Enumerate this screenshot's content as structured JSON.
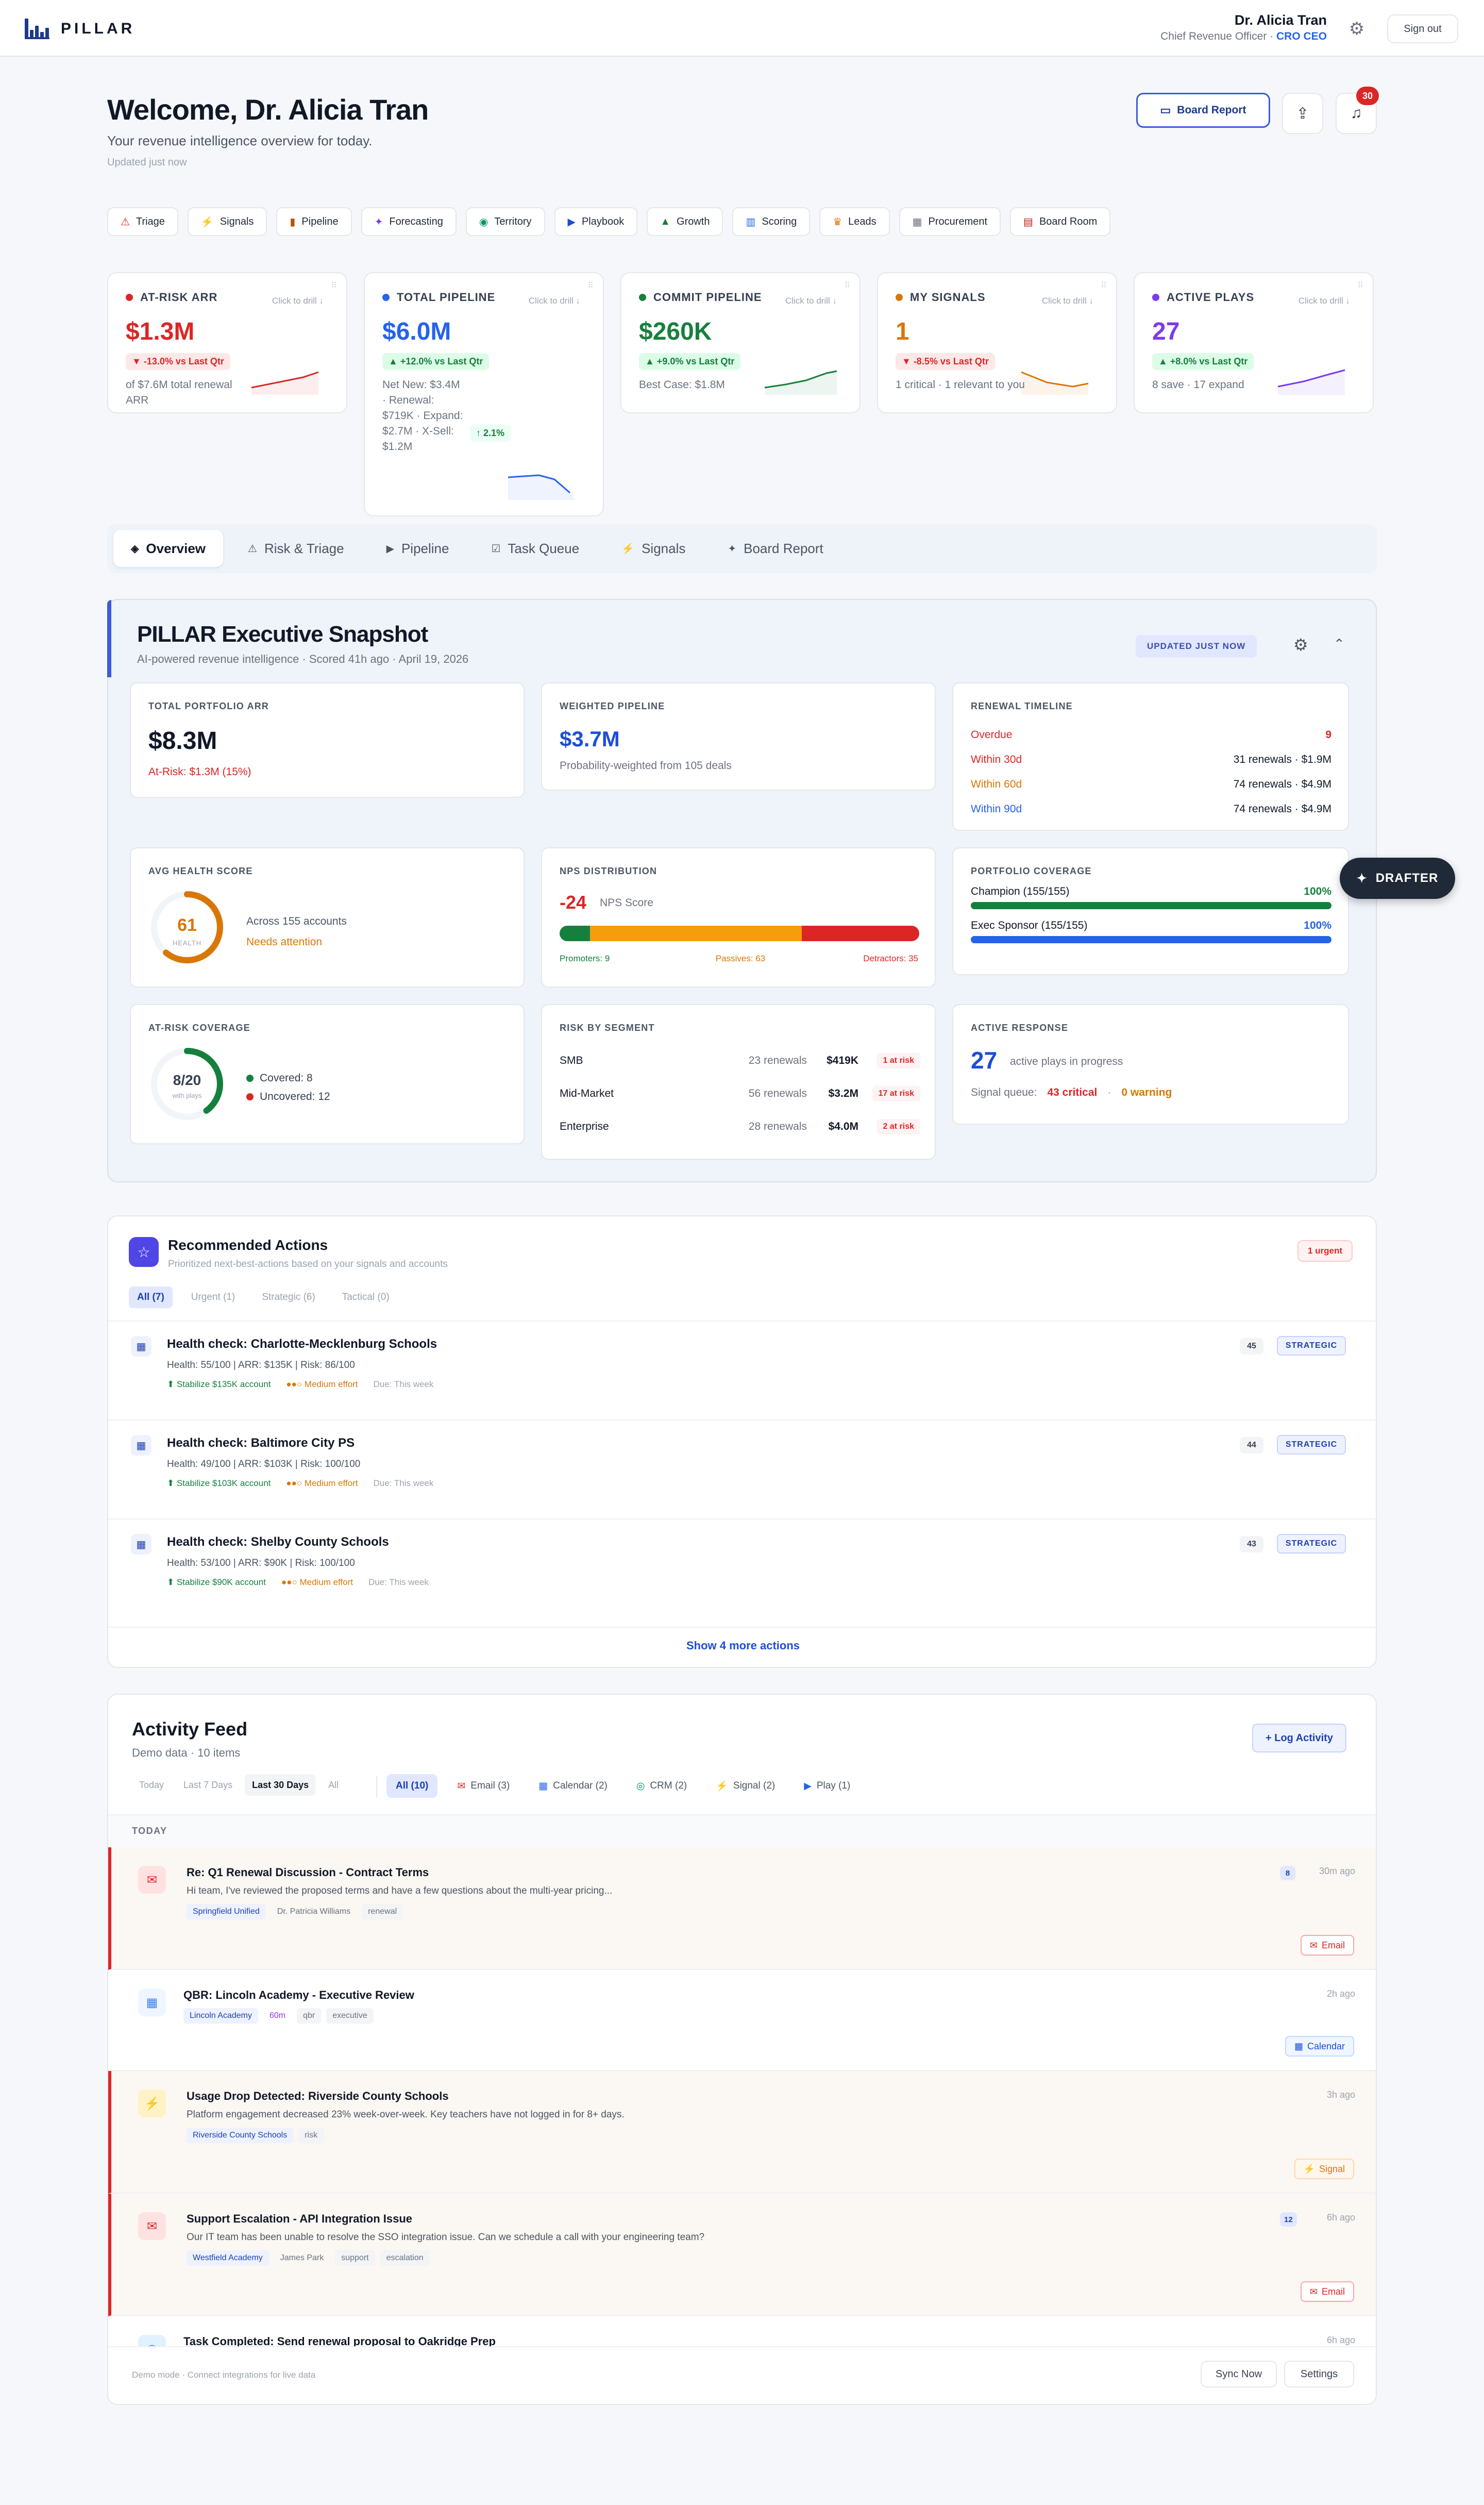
{
  "header": {
    "brand": "PILLAR",
    "user_name": "Dr. Alicia Tran",
    "user_role": "Chief Revenue Officer ·",
    "user_role_link": "CRO CEO",
    "signout_label": "Sign out"
  },
  "page": {
    "title": "Welcome, Dr. Alicia Tran",
    "subtitle": "Your revenue intelligence overview for today.",
    "updated": "Updated just now",
    "board_report_label": "Board Report",
    "notification_count": "30"
  },
  "nav_pills": [
    {
      "label": "Triage",
      "icon": "⚠"
    },
    {
      "label": "Signals",
      "icon": "⚡"
    },
    {
      "label": "Pipeline",
      "icon": "▮"
    },
    {
      "label": "Forecasting",
      "icon": "✦"
    },
    {
      "label": "Territory",
      "icon": "◉"
    },
    {
      "label": "Playbook",
      "icon": "▶"
    },
    {
      "label": "Growth",
      "icon": "▲"
    },
    {
      "label": "Scoring",
      "icon": "▥"
    },
    {
      "label": "Leads",
      "icon": "♛"
    },
    {
      "label": "Procurement",
      "icon": "▦"
    },
    {
      "label": "Board Room",
      "icon": "▤"
    }
  ],
  "kpis": [
    {
      "title": "AT-RISK ARR",
      "drill": "Click to drill ↓",
      "value": "$1.3M",
      "change": "▼ -13.0% vs Last Qtr",
      "note": "of $7.6M total renewal ARR",
      "color": "#dc2626"
    },
    {
      "title": "TOTAL PIPELINE",
      "drill": "Click to drill ↓",
      "value": "$6.0M",
      "change": "▲ +12.0% vs Last Qtr",
      "note": "Net New: $3.4M · Renewal: $719K · Expand: $2.7M · X-Sell: $1.2M",
      "extra": "↑ 2.1%",
      "color": "#2563eb"
    },
    {
      "title": "COMMIT PIPELINE",
      "drill": "Click to drill ↓",
      "value": "$260K",
      "change": "▲ +9.0% vs Last Qtr",
      "note": "Best Case: $1.8M",
      "color": "#15803d"
    },
    {
      "title": "MY SIGNALS",
      "drill": "Click to drill ↓",
      "value": "1",
      "change": "▼ -8.5% vs Last Qtr",
      "note": "1 critical · 1 relevant to you",
      "color": "#d97706"
    },
    {
      "title": "ACTIVE PLAYS",
      "drill": "Click to drill ↓",
      "value": "27",
      "change": "▲ +8.0% vs Last Qtr",
      "note": "8 save · 17 expand",
      "color": "#7c3aed"
    }
  ],
  "tabs": [
    {
      "label": "Overview",
      "icon": "◈"
    },
    {
      "label": "Risk & Triage",
      "icon": "⚠"
    },
    {
      "label": "Pipeline",
      "icon": "▶"
    },
    {
      "label": "Task Queue",
      "icon": "☑"
    },
    {
      "label": "Signals",
      "icon": "⚡"
    },
    {
      "label": "Board Report",
      "icon": "✦"
    }
  ],
  "snapshot": {
    "title": "PILLAR Executive Snapshot",
    "subtitle": "AI-powered revenue intelligence · Scored 41h ago · April 19, 2026",
    "updated_badge": "UPDATED JUST NOW",
    "total_arr": {
      "label": "TOTAL PORTFOLIO ARR",
      "value": "$8.3M",
      "risk": "At-Risk: $1.3M (15%)"
    },
    "weighted": {
      "label": "WEIGHTED PIPELINE",
      "value": "$3.7M",
      "note": "Probability-weighted from 105 deals"
    },
    "renewal": {
      "label": "RENEWAL TIMELINE",
      "rows": [
        {
          "name": "Overdue",
          "value": "9",
          "color": "#dc2626"
        },
        {
          "name": "Within 30d",
          "value": "31 renewals · $1.9M",
          "color": "#dc2626"
        },
        {
          "name": "Within 60d",
          "value": "74 renewals · $4.9M",
          "color": "#d97706"
        },
        {
          "name": "Within 90d",
          "value": "74 renewals · $4.9M",
          "color": "#2563eb"
        }
      ]
    },
    "health": {
      "label": "AVG HEALTH SCORE",
      "score": "61",
      "score_label": "HEALTH",
      "accounts": "Across 155 accounts",
      "status": "Needs attention",
      "fraction": 0.61
    },
    "nps": {
      "label": "NPS DISTRIBUTION",
      "score": "-24",
      "score_label": "NPS Score",
      "promoters": "Promoters: 9",
      "passives": "Passives: 63",
      "detractors": "Detractors: 35",
      "segments": [
        9,
        63,
        35
      ]
    },
    "coverage": {
      "label": "PORTFOLIO COVERAGE",
      "rows": [
        {
          "name": "Champion (155/155)",
          "pct": "100%",
          "color": "#15803d",
          "fraction": 1.0
        },
        {
          "name": "Exec Sponsor (155/155)",
          "pct": "100%",
          "color": "#2563eb",
          "fraction": 1.0
        }
      ]
    },
    "atrisk": {
      "label": "AT-RISK COVERAGE",
      "ratio": "8/20",
      "ratio_label": "with plays",
      "covered": "Covered: 8",
      "uncovered": "Uncovered: 12",
      "fraction": 0.4
    },
    "segment": {
      "label": "RISK BY SEGMENT",
      "rows": [
        {
          "name": "SMB",
          "renewals": "23 renewals",
          "arr": "$419K",
          "risk": "1 at risk"
        },
        {
          "name": "Mid-Market",
          "renewals": "56 renewals",
          "arr": "$3.2M",
          "risk": "17 at risk"
        },
        {
          "name": "Enterprise",
          "renewals": "28 renewals",
          "arr": "$4.0M",
          "risk": "2 at risk"
        }
      ]
    },
    "response": {
      "label": "ACTIVE RESPONSE",
      "count": "27",
      "count_label": "active plays in progress",
      "queue_label": "Signal queue:",
      "critical": "43 critical",
      "warning": "0 warning"
    }
  },
  "drafter_label": "DRAFTER",
  "recommended": {
    "title": "Recommended Actions",
    "subtitle": "Prioritized next-best-actions based on your signals and accounts",
    "urgent_badge": "1 urgent",
    "filters": [
      "All (7)",
      "Urgent (1)",
      "Strategic (6)",
      "Tactical (0)"
    ],
    "items": [
      {
        "title": "Health check: Charlotte-Mecklenburg Schools",
        "meta": "Health: 55/100 | ARR: $135K | Risk: 86/100",
        "impact": "⬆ Stabilize $135K account",
        "effort": "●●○ Medium effort",
        "due": "Due: This week",
        "score": "45",
        "type": "STRATEGIC"
      },
      {
        "title": "Health check: Baltimore City PS",
        "meta": "Health: 49/100 | ARR: $103K | Risk: 100/100",
        "impact": "⬆ Stabilize $103K account",
        "effort": "●●○ Medium effort",
        "due": "Due: This week",
        "score": "44",
        "type": "STRATEGIC"
      },
      {
        "title": "Health check: Shelby County Schools",
        "meta": "Health: 53/100 | ARR: $90K | Risk: 100/100",
        "impact": "⬆ Stabilize $90K account",
        "effort": "●●○ Medium effort",
        "due": "Due: This week",
        "score": "43",
        "type": "STRATEGIC"
      }
    ],
    "show_more": "Show 4 more actions"
  },
  "feed": {
    "title": "Activity Feed",
    "subtitle": "Demo data · 10 items",
    "log_label": "+ Log Activity",
    "time_filters": [
      "Today",
      "Last 7 Days",
      "Last 30 Days",
      "All"
    ],
    "type_filters": [
      {
        "label": "All (10)",
        "icon": ""
      },
      {
        "label": "Email (3)",
        "icon": "✉"
      },
      {
        "label": "Calendar (2)",
        "icon": "▦"
      },
      {
        "label": "CRM (2)",
        "icon": "◎"
      },
      {
        "label": "Signal (2)",
        "icon": "⚡"
      },
      {
        "label": "Play (1)",
        "icon": "▶"
      }
    ],
    "section": "TODAY",
    "items": [
      {
        "title": "Re: Q1 Renewal Discussion - Contract Terms",
        "body": "Hi team, I've reviewed the proposed terms and have a few questions about the multi-year pricing...",
        "tags": [
          "Springfield Unified",
          "Dr. Patricia Williams",
          "renewal"
        ],
        "count": "8",
        "time": "30m ago",
        "kind": "Email",
        "icon": "✉"
      },
      {
        "title": "QBR: Lincoln Academy - Executive Review",
        "body": "",
        "tags": [
          "Lincoln Academy",
          "60m",
          "qbr",
          "executive"
        ],
        "count": "",
        "time": "2h ago",
        "kind": "Calendar",
        "icon": "▦"
      },
      {
        "title": "Usage Drop Detected: Riverside County Schools",
        "body": "Platform engagement decreased 23% week-over-week. Key teachers have not logged in for 8+ days.",
        "tags": [
          "Riverside County Schools",
          "risk"
        ],
        "count": "",
        "time": "3h ago",
        "kind": "Signal",
        "icon": "⚡"
      },
      {
        "title": "Support Escalation - API Integration Issue",
        "body": "Our IT team has been unable to resolve the SSO integration issue. Can we schedule a call with your engineering team?",
        "tags": [
          "Westfield Academy",
          "James Park",
          "support",
          "escalation"
        ],
        "count": "12",
        "time": "6h ago",
        "kind": "Email",
        "icon": "✉"
      },
      {
        "title": "Task Completed: Send renewal proposal to Oakridge Prep",
        "body": "",
        "tags": [],
        "count": "",
        "time": "6h ago",
        "kind": "",
        "icon": "◎"
      }
    ],
    "footer_note": "Demo mode · Connect integrations for live data",
    "sync_label": "Sync Now",
    "settings_label": "Settings"
  }
}
